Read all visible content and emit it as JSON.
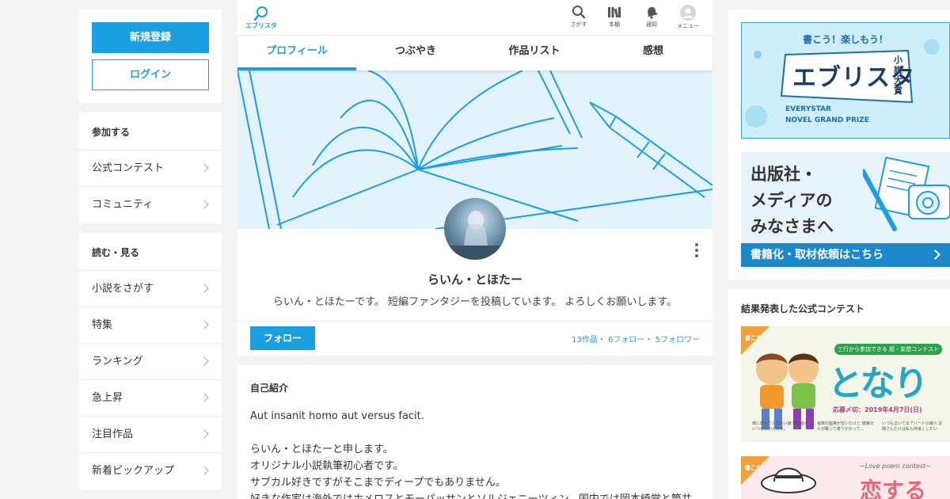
{
  "left": {
    "register_label": "新規登録",
    "login_label": "ログイン",
    "join": {
      "title": "参加する",
      "items": [
        "公式コンテスト",
        "コミュニティ"
      ]
    },
    "read": {
      "title": "読む・見る",
      "items": [
        "小説をさがす",
        "特集",
        "ランキング",
        "急上昇",
        "注目作品",
        "新着ピックアップ"
      ]
    }
  },
  "header": {
    "logo_label": "エブリスタ",
    "icons": [
      {
        "icon": "search-icon",
        "label": "さがす"
      },
      {
        "icon": "bookshelf-icon",
        "label": "本棚"
      },
      {
        "icon": "bell-icon",
        "label": "通知"
      },
      {
        "icon": "user-icon",
        "label": "メニュー"
      }
    ]
  },
  "tabs": [
    "プロフィール",
    "つぶやき",
    "作品リスト",
    "感想"
  ],
  "profile": {
    "name": "らいん・とほたー",
    "description": "らいん・とほたーです。 短編ファンタジーを投稿しています。 よろしくお願いします。",
    "follow_label": "フォロー",
    "works": "13作品",
    "following": "6フォロー",
    "followers": "5フォロワー",
    "sep": "・"
  },
  "intro": {
    "title": "自己紹介",
    "lines": [
      "Aut insanit homo aut versus facit.",
      "",
      "らいん・とほたーと申します。",
      "オリジナル小説執筆初心者です。",
      "サブカル好きですがそこまでディープでもありません。",
      "好きな作家は海外ではホメロスとモーパッサンとソルジェニーツィン。国内では岡本綺堂と筒井"
    ]
  },
  "right": {
    "banner1": {
      "headline": "書こう！楽しもう！",
      "logo": "エブリスタ",
      "badge": "小説大賞",
      "sub1": "EVERYSTAR",
      "sub2": "NOVEL GRAND PRIZE"
    },
    "banner2": {
      "line1": "出版社・",
      "line2": "メディアの",
      "line3": "みなさまへ",
      "strip": "書籍化・取材依頼はこちら"
    },
    "contest_title": "結果発表した公式コンテスト",
    "contest1": {
      "ribbon": "書こう!",
      "tag": "三行から参加できる 超・妄想コンテスト",
      "title": "となり",
      "deadline": "応募〆切：2019年4月7日(日)",
      "notes": [
        "隣に座ってくれない猫 学習塾はいつも私のとなり。",
        "電車の座席が空いたけど 隣席の人が眠って寄りかかって…",
        "いつも泣いてるアパートの隣人 お隣さんだけは私も仲良くしたい"
      ]
    },
    "contest2": {
      "ribbon": "書こう!",
      "subtitle": "~Love poem contest~",
      "title": "恋する"
    }
  },
  "colors": {
    "accent": "#1c9fe0",
    "background": "#f4f4f4"
  }
}
